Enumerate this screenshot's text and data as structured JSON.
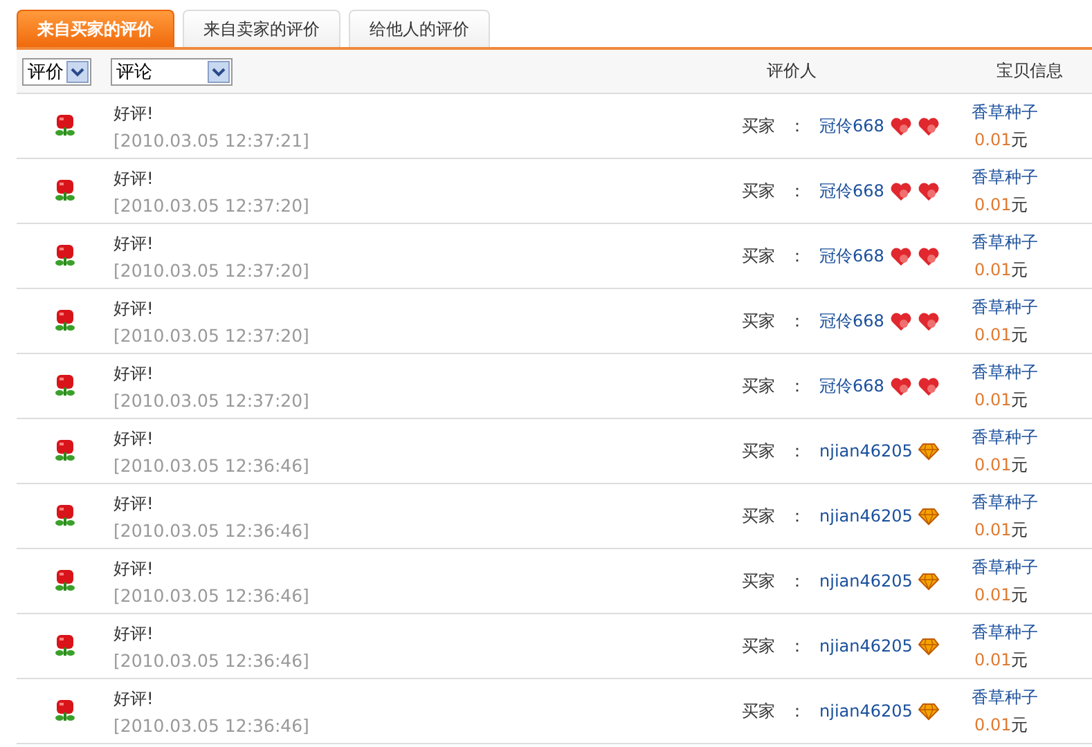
{
  "tabs": [
    {
      "label": "来自买家的评价",
      "selected": true
    },
    {
      "label": "来自卖家的评价",
      "selected": false
    },
    {
      "label": "给他人的评价",
      "selected": false
    }
  ],
  "filters": [
    {
      "value": "评价",
      "kind": "short"
    },
    {
      "value": "评论",
      "kind": "long"
    }
  ],
  "columns": [
    "评价人",
    "宝贝信息"
  ],
  "rows": [
    {
      "rating": {
        "kind": "good"
      },
      "comment": "好评!",
      "time": "[2010.03.05 12:37:21]",
      "role": "买家",
      "separator": "：",
      "name": "冠伶668",
      "badges": [
        {
          "kind": "heart"
        },
        {
          "kind": "heart"
        }
      ],
      "item": "香草种子",
      "price": "0.01",
      "unit": "元"
    },
    {
      "rating": {
        "kind": "good"
      },
      "comment": "好评!",
      "time": "[2010.03.05 12:37:20]",
      "role": "买家",
      "separator": "：",
      "name": "冠伶668",
      "badges": [
        {
          "kind": "heart"
        },
        {
          "kind": "heart"
        }
      ],
      "item": "香草种子",
      "price": "0.01",
      "unit": "元"
    },
    {
      "rating": {
        "kind": "good"
      },
      "comment": "好评!",
      "time": "[2010.03.05 12:37:20]",
      "role": "买家",
      "separator": "：",
      "name": "冠伶668",
      "badges": [
        {
          "kind": "heart"
        },
        {
          "kind": "heart"
        }
      ],
      "item": "香草种子",
      "price": "0.01",
      "unit": "元"
    },
    {
      "rating": {
        "kind": "good"
      },
      "comment": "好评!",
      "time": "[2010.03.05 12:37:20]",
      "role": "买家",
      "separator": "：",
      "name": "冠伶668",
      "badges": [
        {
          "kind": "heart"
        },
        {
          "kind": "heart"
        }
      ],
      "item": "香草种子",
      "price": "0.01",
      "unit": "元"
    },
    {
      "rating": {
        "kind": "good"
      },
      "comment": "好评!",
      "time": "[2010.03.05 12:37:20]",
      "role": "买家",
      "separator": "：",
      "name": "冠伶668",
      "badges": [
        {
          "kind": "heart"
        },
        {
          "kind": "heart"
        }
      ],
      "item": "香草种子",
      "price": "0.01",
      "unit": "元"
    },
    {
      "rating": {
        "kind": "good"
      },
      "comment": "好评!",
      "time": "[2010.03.05 12:36:46]",
      "role": "买家",
      "separator": "：",
      "name": "njian46205",
      "badges": [
        {
          "kind": "diamond"
        }
      ],
      "item": "香草种子",
      "price": "0.01",
      "unit": "元"
    },
    {
      "rating": {
        "kind": "good"
      },
      "comment": "好评!",
      "time": "[2010.03.05 12:36:46]",
      "role": "买家",
      "separator": "：",
      "name": "njian46205",
      "badges": [
        {
          "kind": "diamond"
        }
      ],
      "item": "香草种子",
      "price": "0.01",
      "unit": "元"
    },
    {
      "rating": {
        "kind": "good"
      },
      "comment": "好评!",
      "time": "[2010.03.05 12:36:46]",
      "role": "买家",
      "separator": "：",
      "name": "njian46205",
      "badges": [
        {
          "kind": "diamond"
        }
      ],
      "item": "香草种子",
      "price": "0.01",
      "unit": "元"
    },
    {
      "rating": {
        "kind": "good"
      },
      "comment": "好评!",
      "time": "[2010.03.05 12:36:46]",
      "role": "买家",
      "separator": "：",
      "name": "njian46205",
      "badges": [
        {
          "kind": "diamond"
        }
      ],
      "item": "香草种子",
      "price": "0.01",
      "unit": "元"
    },
    {
      "rating": {
        "kind": "good"
      },
      "comment": "好评!",
      "time": "[2010.03.05 12:36:46]",
      "role": "买家",
      "separator": "：",
      "name": "njian46205",
      "badges": [
        {
          "kind": "diamond"
        }
      ],
      "item": "香草种子",
      "price": "0.01",
      "unit": "元"
    }
  ]
}
